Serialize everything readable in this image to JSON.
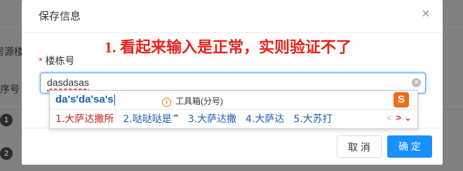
{
  "background": {
    "label_source": "房源楼",
    "label_seq": "序号",
    "row_numbers": [
      "1",
      "2"
    ]
  },
  "modal": {
    "title": "保存信息",
    "close_glyph": "×",
    "annotation": "1. 看起来输入是正常，实则验证不了",
    "field": {
      "required_mark": "*",
      "label": "楼栋号",
      "value": "dasdasas"
    },
    "footer": {
      "cancel_label": "取 消",
      "ok_label": "确 定"
    }
  },
  "ime": {
    "pinyin": "da's'da'sa's",
    "hint": "工具箱(分号)",
    "hint_icon": "i",
    "logo": "S",
    "candidates": [
      {
        "text": "1.大萨达撒所"
      },
      {
        "text": "2.哒哒哒是"
      },
      {
        "text": "3.大萨达撒"
      },
      {
        "text": "4.大萨达"
      },
      {
        "text": "5.大苏打"
      }
    ],
    "nav_prev": "<",
    "nav_next": ">",
    "nav_more": "⌄"
  },
  "colors": {
    "primary": "#1890ff",
    "annotation": "#e8221b",
    "ime_blue": "#1a5fb4",
    "ime_first": "#c81e1e"
  }
}
